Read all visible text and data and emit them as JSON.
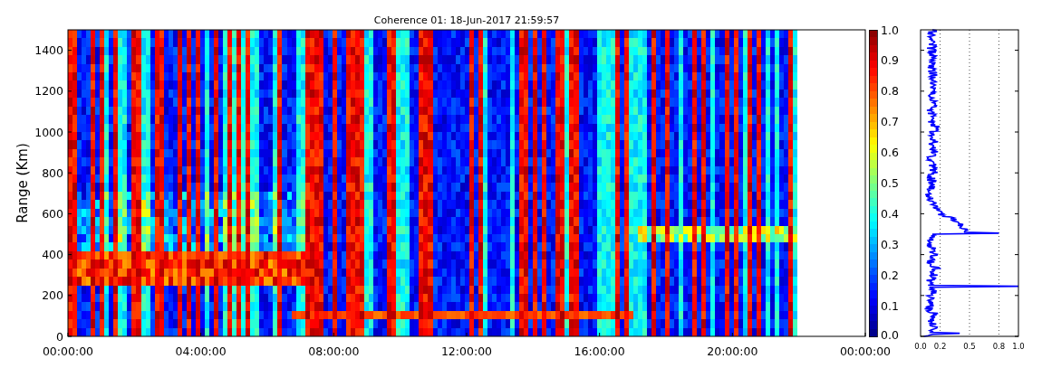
{
  "title": "Coherence 01: 18-Jun-2017 21:59:57",
  "heatmap": {
    "kind": "picture",
    "ylabel": "Range (Km)",
    "yticks": [
      "1400",
      "1200",
      "1000",
      "800",
      "600",
      "400",
      "200",
      "0"
    ],
    "xticks": [
      "00:00:00",
      "04:00:00",
      "08:00:00",
      "12:00:00",
      "16:00:00",
      "20:00:00",
      "00:00:00"
    ]
  },
  "colorbar": {
    "ticks": [
      "1.0",
      "0.9",
      "0.8",
      "0.7",
      "0.6",
      "0.5",
      "0.4",
      "0.3",
      "0.2",
      "0.1",
      "0.0"
    ]
  },
  "profile": {
    "kind": "picture",
    "xticks": [
      "0.0",
      "0.2",
      "0.5",
      "0.8",
      "1.0"
    ]
  }
}
